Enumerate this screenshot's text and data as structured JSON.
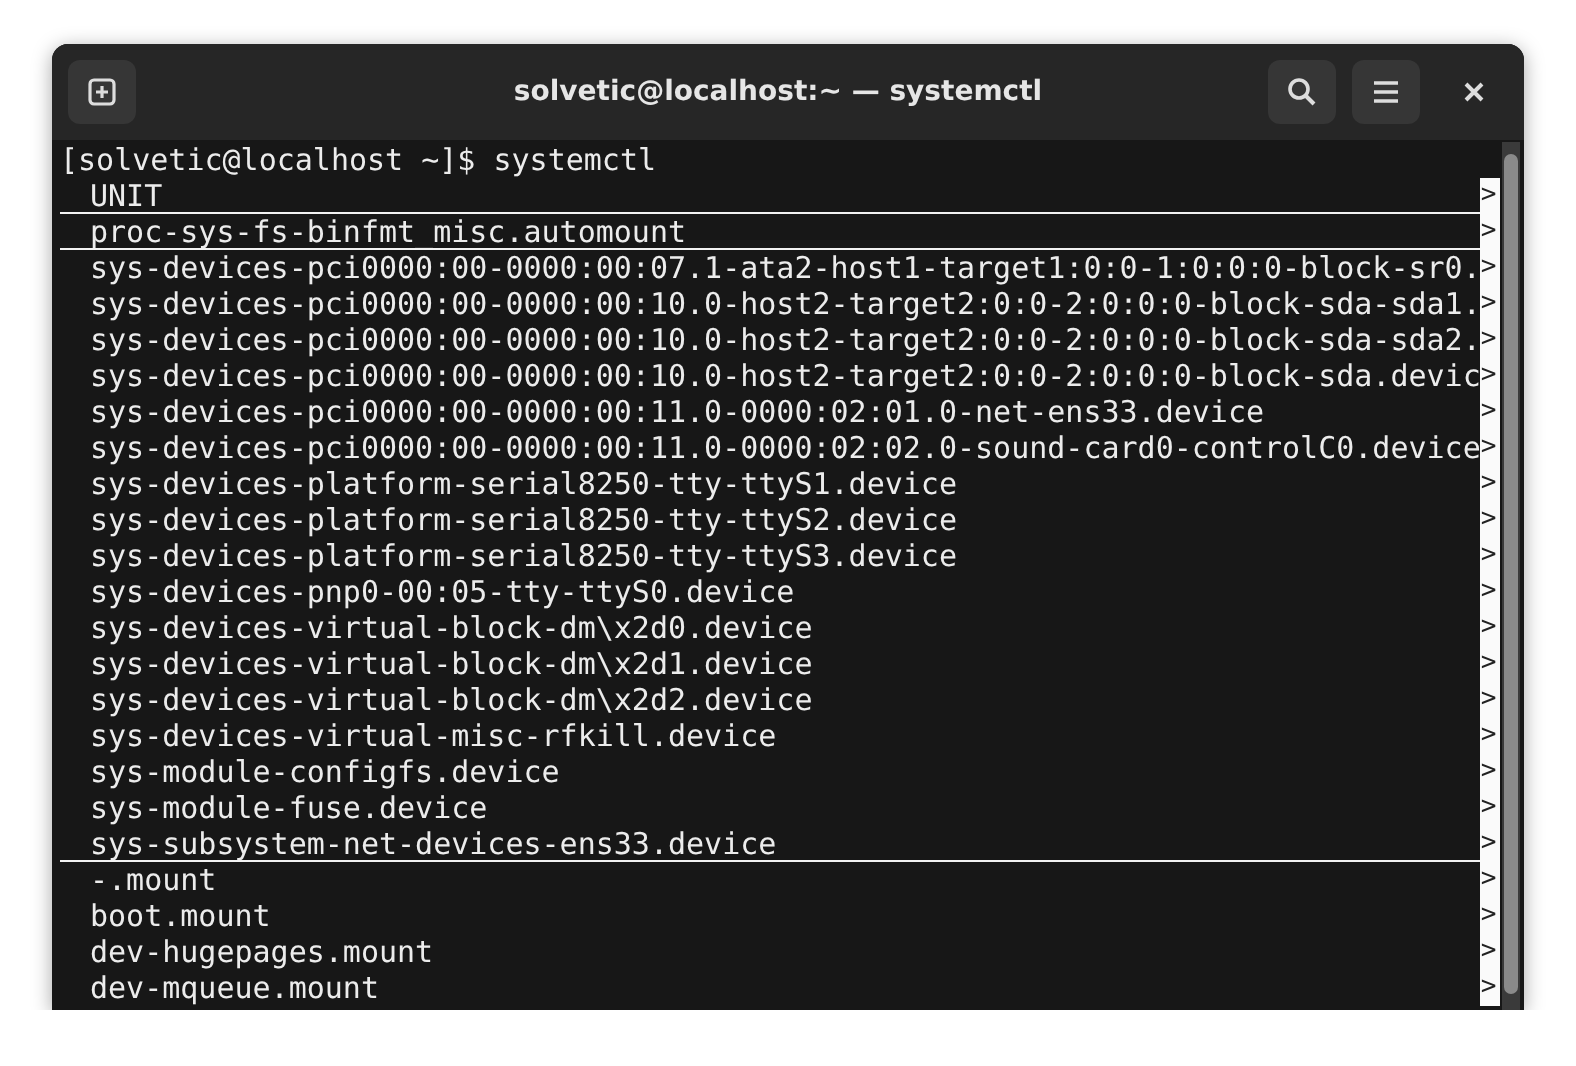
{
  "window": {
    "title": "solvetic@localhost:~ — systemctl"
  },
  "terminal": {
    "lines": [
      {
        "kind": "prompt",
        "text": "[solvetic@localhost ~]$ systemctl",
        "underlined": false,
        "truncated": false
      },
      {
        "kind": "unit",
        "text": "UNIT",
        "underlined": true,
        "truncated": true
      },
      {
        "kind": "unit",
        "text": "proc-sys-fs-binfmt_misc.automount",
        "underlined": true,
        "truncated": true
      },
      {
        "kind": "unit",
        "text": "sys-devices-pci0000:00-0000:00:07.1-ata2-host1-target1:0:0-1:0:0:0-block-sr0.",
        "underlined": false,
        "truncated": true
      },
      {
        "kind": "unit",
        "text": "sys-devices-pci0000:00-0000:00:10.0-host2-target2:0:0-2:0:0:0-block-sda-sda1.",
        "underlined": false,
        "truncated": true
      },
      {
        "kind": "unit",
        "text": "sys-devices-pci0000:00-0000:00:10.0-host2-target2:0:0-2:0:0:0-block-sda-sda2.",
        "underlined": false,
        "truncated": true
      },
      {
        "kind": "unit",
        "text": "sys-devices-pci0000:00-0000:00:10.0-host2-target2:0:0-2:0:0:0-block-sda.devic",
        "underlined": false,
        "truncated": true
      },
      {
        "kind": "unit",
        "text": "sys-devices-pci0000:00-0000:00:11.0-0000:02:01.0-net-ens33.device",
        "underlined": false,
        "truncated": true
      },
      {
        "kind": "unit",
        "text": "sys-devices-pci0000:00-0000:00:11.0-0000:02:02.0-sound-card0-controlC0.device",
        "underlined": false,
        "truncated": true
      },
      {
        "kind": "unit",
        "text": "sys-devices-platform-serial8250-tty-ttyS1.device",
        "underlined": false,
        "truncated": true
      },
      {
        "kind": "unit",
        "text": "sys-devices-platform-serial8250-tty-ttyS2.device",
        "underlined": false,
        "truncated": true
      },
      {
        "kind": "unit",
        "text": "sys-devices-platform-serial8250-tty-ttyS3.device",
        "underlined": false,
        "truncated": true
      },
      {
        "kind": "unit",
        "text": "sys-devices-pnp0-00:05-tty-ttyS0.device",
        "underlined": false,
        "truncated": true
      },
      {
        "kind": "unit",
        "text": "sys-devices-virtual-block-dm\\x2d0.device",
        "underlined": false,
        "truncated": true
      },
      {
        "kind": "unit",
        "text": "sys-devices-virtual-block-dm\\x2d1.device",
        "underlined": false,
        "truncated": true
      },
      {
        "kind": "unit",
        "text": "sys-devices-virtual-block-dm\\x2d2.device",
        "underlined": false,
        "truncated": true
      },
      {
        "kind": "unit",
        "text": "sys-devices-virtual-misc-rfkill.device",
        "underlined": false,
        "truncated": true
      },
      {
        "kind": "unit",
        "text": "sys-module-configfs.device",
        "underlined": false,
        "truncated": true
      },
      {
        "kind": "unit",
        "text": "sys-module-fuse.device",
        "underlined": false,
        "truncated": true
      },
      {
        "kind": "unit",
        "text": "sys-subsystem-net-devices-ens33.device",
        "underlined": true,
        "truncated": true
      },
      {
        "kind": "unit",
        "text": "-.mount",
        "underlined": false,
        "truncated": true
      },
      {
        "kind": "unit",
        "text": "boot.mount",
        "underlined": false,
        "truncated": true
      },
      {
        "kind": "unit",
        "text": "dev-hugepages.mount",
        "underlined": false,
        "truncated": true
      },
      {
        "kind": "unit",
        "text": "dev-mqueue.mount",
        "underlined": false,
        "truncated": true
      }
    ],
    "marker": ">"
  }
}
